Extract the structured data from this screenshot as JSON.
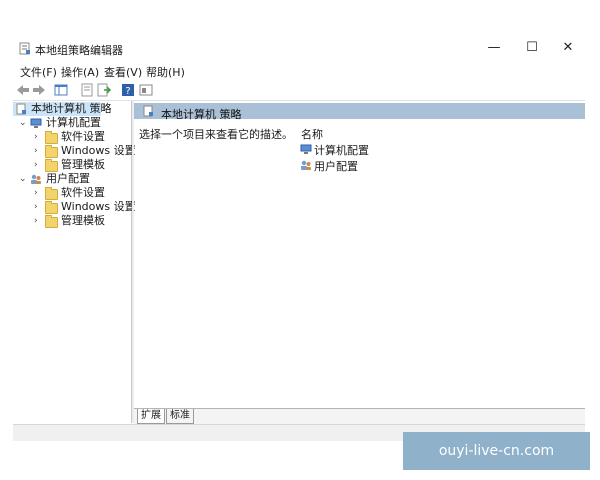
{
  "window": {
    "title": "本地组策略编辑器",
    "minimize": "—",
    "maximize": "☐",
    "close": "✕"
  },
  "menu": [
    {
      "label": "文件(F)"
    },
    {
      "label": "操作(A)"
    },
    {
      "label": "查看(V)"
    },
    {
      "label": "帮助(H)"
    }
  ],
  "tree": {
    "root": "本地计算机 策略",
    "computer": {
      "label": "计算机配置",
      "children": [
        "软件设置",
        "Windows 设置",
        "管理模板"
      ]
    },
    "user": {
      "label": "用户配置",
      "children": [
        "软件设置",
        "Windows 设置",
        "管理模板"
      ]
    }
  },
  "content": {
    "header": "本地计算机 策略",
    "description": "选择一个项目来查看它的描述。",
    "column_name": "名称",
    "items": [
      "计算机配置",
      "用户配置"
    ]
  },
  "tabs": [
    "扩展",
    "标准"
  ],
  "watermark": "ouyi-live-cn.com",
  "colors": {
    "header_band": "#a9c0d6",
    "selection": "#cce4f7",
    "watermark_bg": "#8fb1c9"
  }
}
